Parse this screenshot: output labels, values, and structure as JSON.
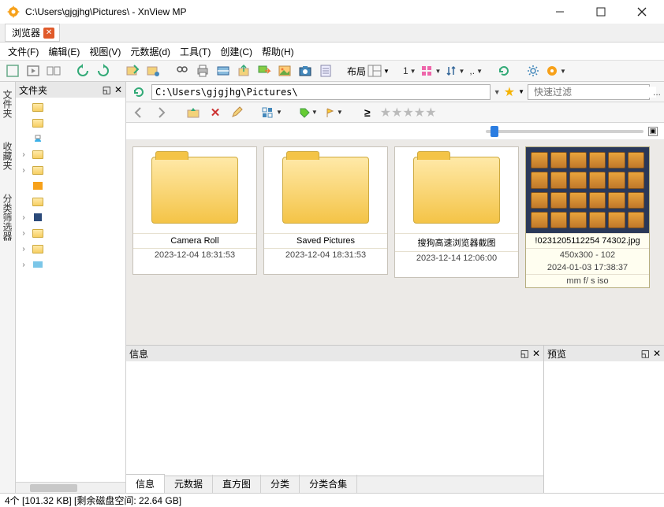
{
  "window": {
    "title": "C:\\Users\\gjgjhg\\Pictures\\ - XnView MP"
  },
  "tabs": {
    "browser": "浏览器"
  },
  "menu": {
    "file": "文件(F)",
    "edit": "编辑(E)",
    "view": "视图(V)",
    "metadata": "元数据(d)",
    "tools": "工具(T)",
    "create": "创建(C)",
    "help": "帮助(H)"
  },
  "toolbar": {
    "layout_label": "布局",
    "num1": "1",
    "punct": ",."
  },
  "tree": {
    "header": "文件夹"
  },
  "sidetabs": {
    "folders": "文件夹",
    "favorites": "收藏夹",
    "classify": "分类筛选器"
  },
  "address": {
    "path": "C:\\Users\\gjgjhg\\Pictures\\",
    "filter_placeholder": "快速过滤",
    "dots": "..."
  },
  "nav": {
    "ge": "≥"
  },
  "items": [
    {
      "name": "Camera Roll",
      "date": "2023-12-04 18:31:53",
      "type": "folder"
    },
    {
      "name": "Saved Pictures",
      "date": "2023-12-04 18:31:53",
      "type": "folder"
    },
    {
      "name": "搜狗高速浏览器截图",
      "date": "2023-12-14 12:06:00",
      "type": "folder"
    },
    {
      "name": "!0231205112254 74302.jpg",
      "dim": "450x300 - 102",
      "date": "2024-01-03 17:38:37",
      "exif": "mm f/ s iso",
      "type": "image"
    }
  ],
  "panels": {
    "info": "信息",
    "preview": "预览"
  },
  "info_tabs": {
    "info": "信息",
    "meta": "元数据",
    "histogram": "直方图",
    "classify": "分类",
    "collection": "分类合集"
  },
  "status": "4个 [101.32 KB]   [剩余磁盘空间: 22.64 GB]"
}
